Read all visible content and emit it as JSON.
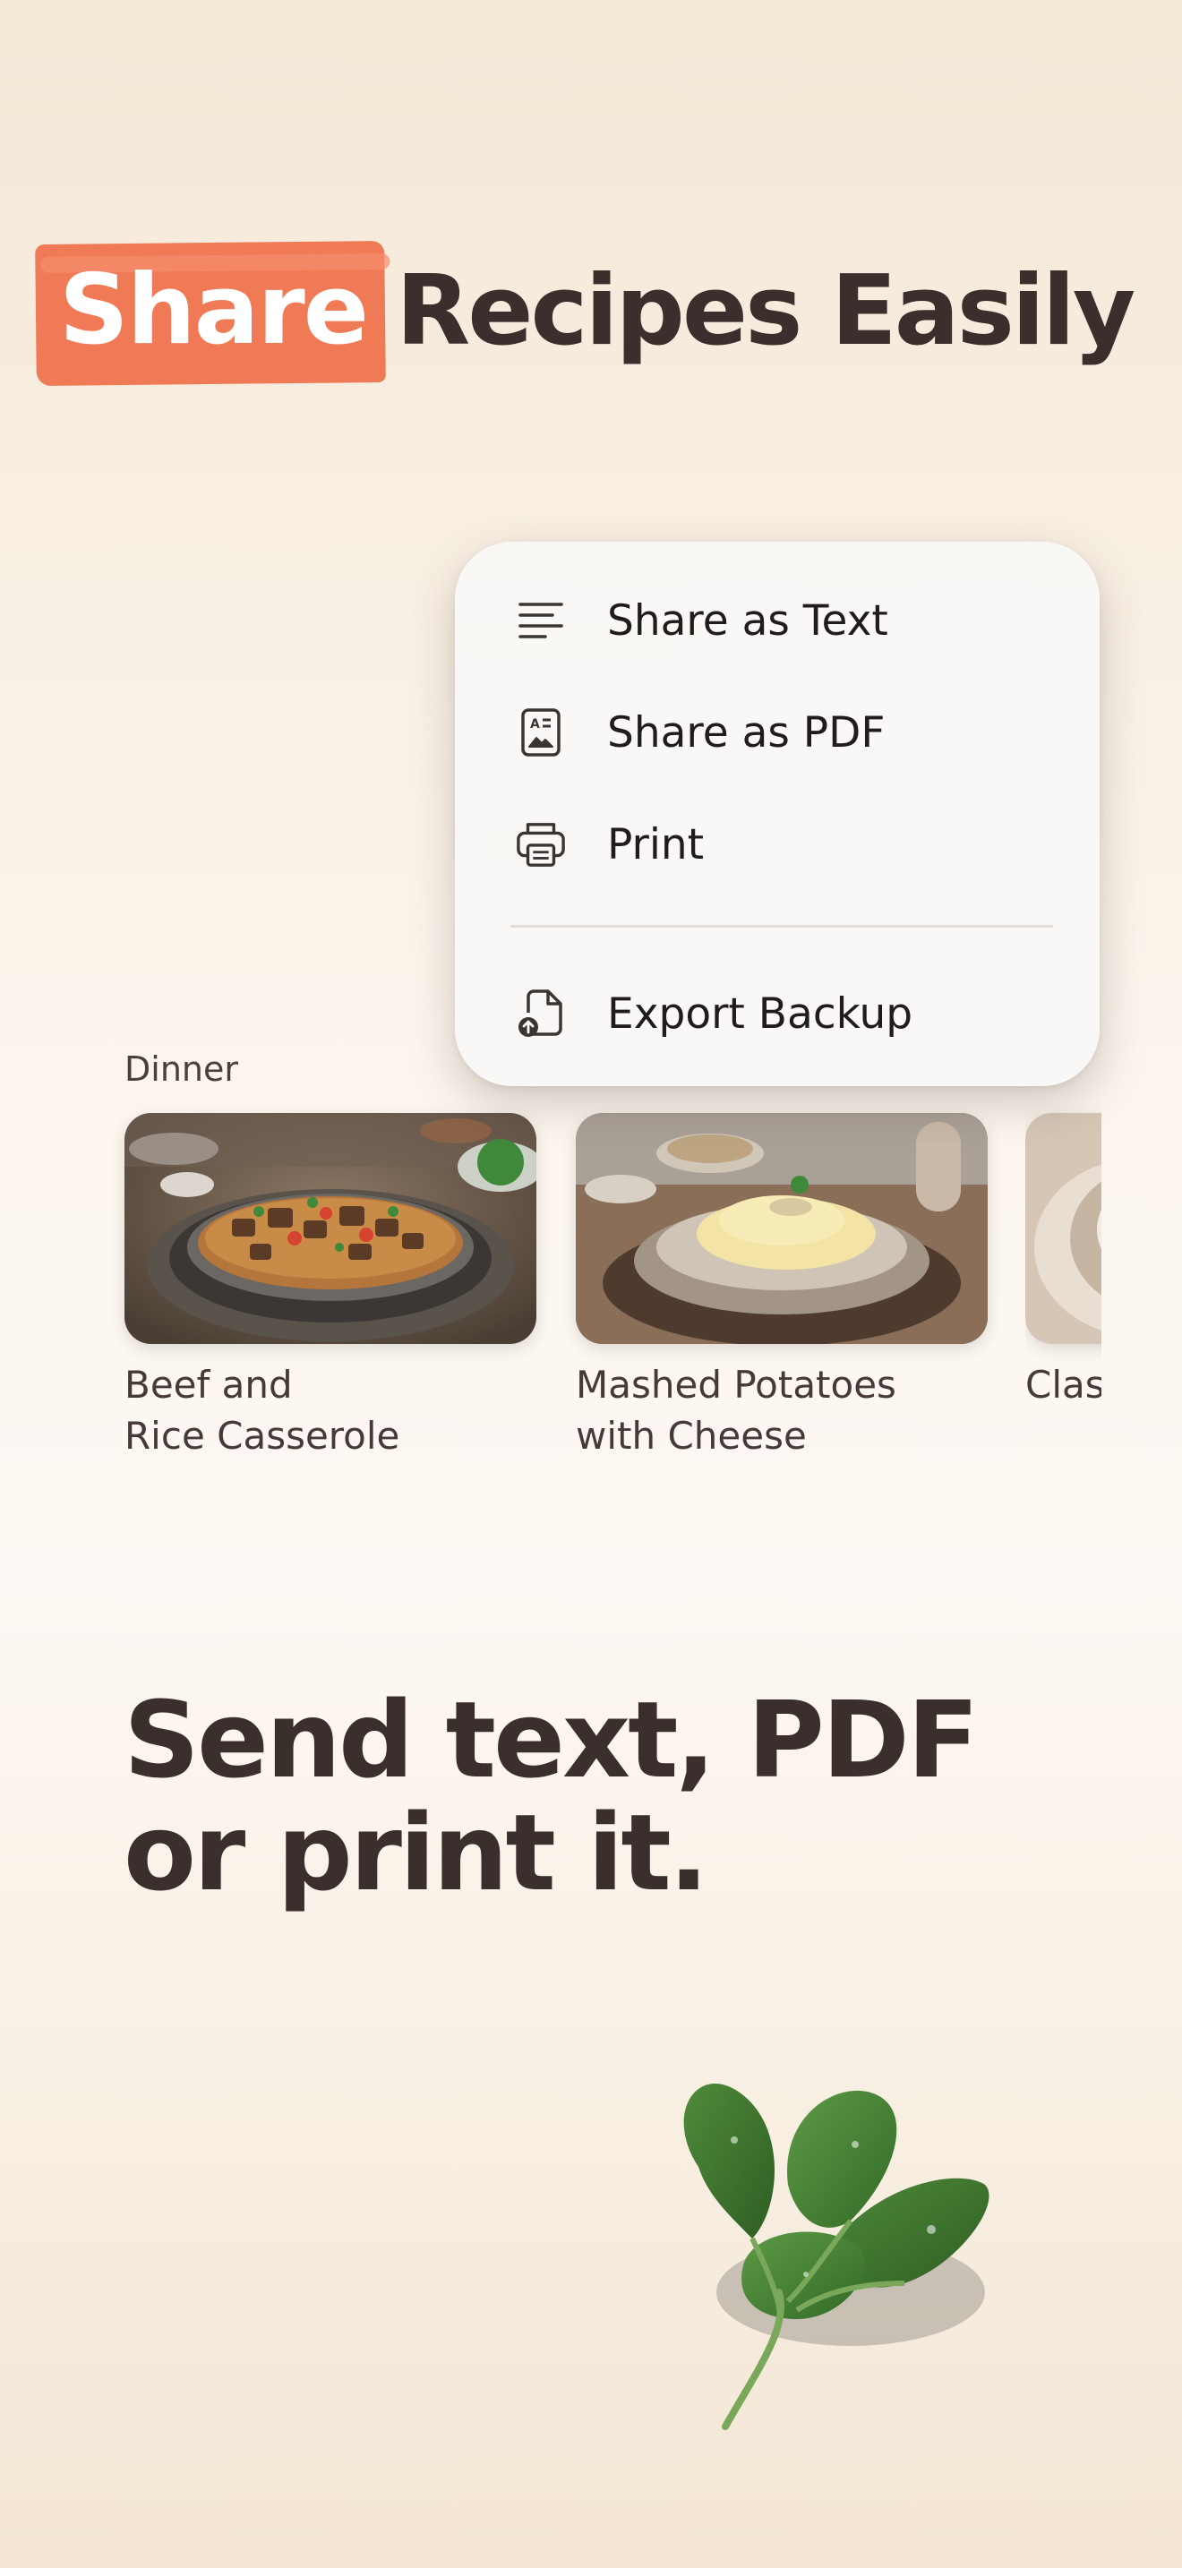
{
  "headline": {
    "highlight": "Share",
    "rest": "Recipes Easily"
  },
  "share_menu": {
    "items": [
      {
        "label": "Share as Text",
        "icon": "text-lines-icon"
      },
      {
        "label": "Share as PDF",
        "icon": "pdf-document-icon"
      },
      {
        "label": "Print",
        "icon": "printer-icon"
      }
    ],
    "secondary_items": [
      {
        "label": "Export Backup",
        "icon": "export-file-icon"
      }
    ]
  },
  "recipes": [
    {
      "category": "Dinner",
      "title_line1": "Beef and",
      "title_line2": "Rice Casserole",
      "image": "beef-rice-casserole-photo"
    },
    {
      "category": "",
      "title_line1": "Mashed Potatoes",
      "title_line2": "with Cheese",
      "image": "mashed-potatoes-photo"
    },
    {
      "category": "",
      "title_line1": "Clas",
      "title_line2": "",
      "image": "third-dish-photo"
    }
  ],
  "tagline": {
    "line1": "Send text,  PDF",
    "line2": "or print it."
  },
  "colors": {
    "accent": "#f07a55",
    "heading": "#3b2f2e",
    "menu_background": "#faf8f6"
  },
  "decoration": "spinach-leaves-image"
}
